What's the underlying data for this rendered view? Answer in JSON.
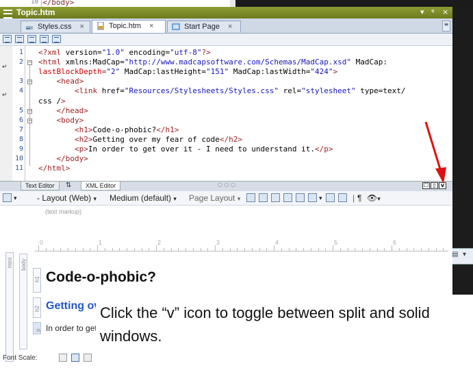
{
  "top_window": {
    "line_number": "10",
    "code_fragment": "</body>"
  },
  "window": {
    "title": "Topic.htm",
    "controls": [
      "▾",
      "ᵠ",
      "×"
    ],
    "tabs": [
      {
        "label": "Styles.css",
        "close": "×"
      },
      {
        "label": "Topic.htm",
        "close": "×"
      },
      {
        "label": "Start Page",
        "close": "×"
      }
    ]
  },
  "editor": {
    "line_numbers": [
      "1",
      "2",
      "",
      "3",
      "4",
      "",
      "5",
      "6",
      "7",
      "8",
      "9",
      "10",
      "11"
    ],
    "lines": [
      "<?xml version=\"1.0\" encoding=\"utf-8\"?>",
      "<html xmlns:MadCap=\"http://www.madcapsoftware.com/Schemas/MadCap.xsd\" MadCap:",
      "lastBlockDepth=\"2\" MadCap:lastHeight=\"151\" MadCap:lastWidth=\"424\">",
      "    <head>",
      "        <link href=\"Resources/Stylesheets/Styles.css\" rel=\"stylesheet\" type=\"text/",
      "css\" />",
      "    </head>",
      "    <body>",
      "        <h1>Code-o-phobic?</h1>",
      "        <h2>Getting over my fear of code</h2>",
      "        <p>In order to get over it - I need to understand it.</p>",
      "    </body>",
      "</html>"
    ]
  },
  "bottom_tabs": {
    "text_editor": "Text Editor",
    "xml_editor": "XML Editor",
    "dots": "○ ○ ○"
  },
  "split_buttons": [
    "☐",
    "▯",
    "v"
  ],
  "toolbar2": {
    "layout": "Layout (Web)",
    "medium": "Medium (default)",
    "page_layout": "Page Layout",
    "pilcrow": "¶"
  },
  "xml_editor": {
    "text_markup": "(text markup)",
    "ruler_numbers": [
      "0",
      "1",
      "2",
      "3",
      "4",
      "5",
      "6"
    ],
    "structure_labels": [
      "html",
      "body",
      "h1",
      "h2",
      "p"
    ],
    "h1": "Code-o-phobic?",
    "h2": "Getting over my fear of code",
    "p": "In order to get over it - I need to understand it.",
    "font_scale": "Font Scale:"
  },
  "callout": {
    "text": "Click the “v” icon to toggle between split and solid windows."
  },
  "colors": {
    "title_bar": "#7f8c28",
    "arrow": "#e01010",
    "h2": "#2255cc"
  }
}
